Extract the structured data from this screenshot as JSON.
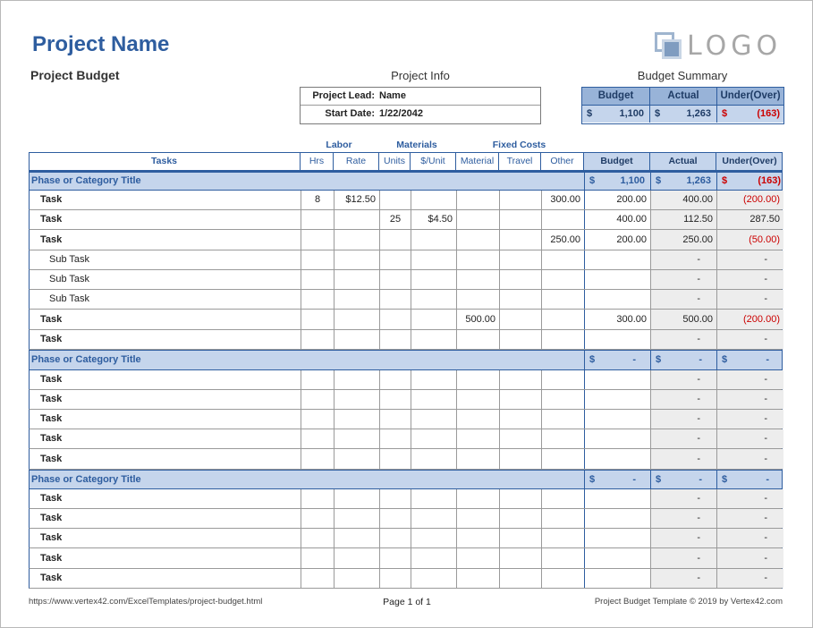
{
  "header": {
    "project_name": "Project Name",
    "subtitle": "Project Budget",
    "logo_text": "LOGO"
  },
  "project_info": {
    "title": "Project Info",
    "lead_label": "Project Lead:",
    "lead_value": "Name",
    "start_label": "Start Date:",
    "start_value": "1/22/2042"
  },
  "budget_summary": {
    "title": "Budget Summary",
    "headers": [
      "Budget",
      "Actual",
      "Under(Over)"
    ],
    "currency": "$",
    "budget": "1,100",
    "actual": "1,263",
    "under_over": "(163)"
  },
  "table": {
    "group_headers": {
      "labor": "Labor",
      "materials": "Materials",
      "fixed_costs": "Fixed Costs"
    },
    "columns": [
      "Tasks",
      "Hrs",
      "Rate",
      "Units",
      "$/Unit",
      "Material",
      "Travel",
      "Other",
      "Budget",
      "Actual",
      "Under(Over)"
    ],
    "rows": [
      {
        "type": "phase",
        "title": "Phase or Category Title",
        "cur": "$",
        "budget": "1,100",
        "actual": "1,263",
        "under": "(163)"
      },
      {
        "type": "task",
        "name": "Task",
        "hrs": "8",
        "rate": "$12.50",
        "units": "",
        "unit_price": "",
        "material": "",
        "travel": "",
        "other": "300.00",
        "budget": "200.00",
        "actual": "400.00",
        "under": "(200.00)"
      },
      {
        "type": "task",
        "name": "Task",
        "hrs": "",
        "rate": "",
        "units": "25",
        "unit_price": "$4.50",
        "material": "",
        "travel": "",
        "other": "",
        "budget": "400.00",
        "actual": "112.50",
        "under": "287.50"
      },
      {
        "type": "task",
        "name": "Task",
        "hrs": "",
        "rate": "",
        "units": "",
        "unit_price": "",
        "material": "",
        "travel": "",
        "other": "250.00",
        "budget": "200.00",
        "actual": "250.00",
        "under": "(50.00)"
      },
      {
        "type": "sub",
        "name": "Sub Task",
        "hrs": "",
        "rate": "",
        "units": "",
        "unit_price": "",
        "material": "",
        "travel": "",
        "other": "",
        "budget": "",
        "actual": "-",
        "under": "-"
      },
      {
        "type": "sub",
        "name": "Sub Task",
        "hrs": "",
        "rate": "",
        "units": "",
        "unit_price": "",
        "material": "",
        "travel": "",
        "other": "",
        "budget": "",
        "actual": "-",
        "under": "-"
      },
      {
        "type": "sub",
        "name": "Sub Task",
        "hrs": "",
        "rate": "",
        "units": "",
        "unit_price": "",
        "material": "",
        "travel": "",
        "other": "",
        "budget": "",
        "actual": "-",
        "under": "-"
      },
      {
        "type": "task",
        "name": "Task",
        "hrs": "",
        "rate": "",
        "units": "",
        "unit_price": "",
        "material": "500.00",
        "travel": "",
        "other": "",
        "budget": "300.00",
        "actual": "500.00",
        "under": "(200.00)"
      },
      {
        "type": "task",
        "name": "Task",
        "hrs": "",
        "rate": "",
        "units": "",
        "unit_price": "",
        "material": "",
        "travel": "",
        "other": "",
        "budget": "",
        "actual": "-",
        "under": "-"
      },
      {
        "type": "phase",
        "title": "Phase or Category Title",
        "cur": "$",
        "budget": "-",
        "actual": "-",
        "under": "-"
      },
      {
        "type": "task",
        "name": "Task",
        "hrs": "",
        "rate": "",
        "units": "",
        "unit_price": "",
        "material": "",
        "travel": "",
        "other": "",
        "budget": "",
        "actual": "-",
        "under": "-"
      },
      {
        "type": "task",
        "name": "Task",
        "hrs": "",
        "rate": "",
        "units": "",
        "unit_price": "",
        "material": "",
        "travel": "",
        "other": "",
        "budget": "",
        "actual": "-",
        "under": "-"
      },
      {
        "type": "task",
        "name": "Task",
        "hrs": "",
        "rate": "",
        "units": "",
        "unit_price": "",
        "material": "",
        "travel": "",
        "other": "",
        "budget": "",
        "actual": "-",
        "under": "-"
      },
      {
        "type": "task",
        "name": "Task",
        "hrs": "",
        "rate": "",
        "units": "",
        "unit_price": "",
        "material": "",
        "travel": "",
        "other": "",
        "budget": "",
        "actual": "-",
        "under": "-"
      },
      {
        "type": "task",
        "name": "Task",
        "hrs": "",
        "rate": "",
        "units": "",
        "unit_price": "",
        "material": "",
        "travel": "",
        "other": "",
        "budget": "",
        "actual": "-",
        "under": "-"
      },
      {
        "type": "phase",
        "title": "Phase or Category Title",
        "cur": "$",
        "budget": "-",
        "actual": "-",
        "under": "-"
      },
      {
        "type": "task",
        "name": "Task",
        "hrs": "",
        "rate": "",
        "units": "",
        "unit_price": "",
        "material": "",
        "travel": "",
        "other": "",
        "budget": "",
        "actual": "-",
        "under": "-"
      },
      {
        "type": "task",
        "name": "Task",
        "hrs": "",
        "rate": "",
        "units": "",
        "unit_price": "",
        "material": "",
        "travel": "",
        "other": "",
        "budget": "",
        "actual": "-",
        "under": "-"
      },
      {
        "type": "task",
        "name": "Task",
        "hrs": "",
        "rate": "",
        "units": "",
        "unit_price": "",
        "material": "",
        "travel": "",
        "other": "",
        "budget": "",
        "actual": "-",
        "under": "-"
      },
      {
        "type": "task",
        "name": "Task",
        "hrs": "",
        "rate": "",
        "units": "",
        "unit_price": "",
        "material": "",
        "travel": "",
        "other": "",
        "budget": "",
        "actual": "-",
        "under": "-"
      },
      {
        "type": "task",
        "name": "Task",
        "hrs": "",
        "rate": "",
        "units": "",
        "unit_price": "",
        "material": "",
        "travel": "",
        "other": "",
        "budget": "",
        "actual": "-",
        "under": "-"
      }
    ]
  },
  "footer": {
    "url": "https://www.vertex42.com/ExcelTemplates/project-budget.html",
    "page": "Page 1 of 1",
    "copyright": "Project Budget Template © 2019 by Vertex42.com"
  },
  "colors": {
    "accent": "#2e5d9f",
    "phase_fill": "#c5d5ec",
    "summary_header_fill": "#98b3d8",
    "computed_fill": "#ededed",
    "negative": "#cc0000"
  }
}
